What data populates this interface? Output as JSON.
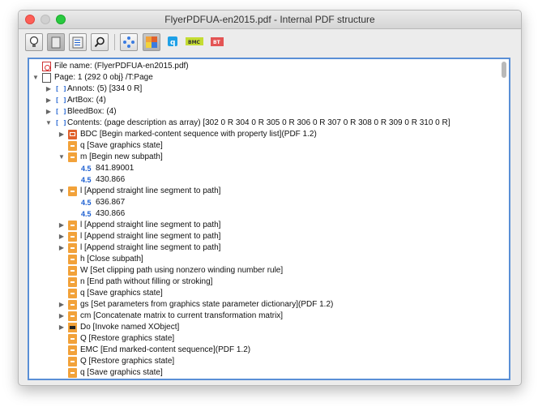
{
  "window": {
    "title": "FlyerPDFUA-en2015.pdf - Internal PDF structure"
  },
  "toolbar": {
    "buttons": [
      {
        "name": "bulb-icon-button",
        "icon": "lightbulb"
      },
      {
        "name": "page-view-button",
        "icon": "page",
        "active": true
      },
      {
        "name": "structure-view-button",
        "icon": "document-structure"
      },
      {
        "name": "search-button",
        "icon": "magnifier"
      },
      {
        "name": "nodes-button",
        "icon": "diamond-nodes"
      },
      {
        "name": "tree-colored-button",
        "icon": "colored-tree",
        "active": true
      },
      {
        "name": "q-button",
        "icon": "q-tag"
      },
      {
        "name": "bmc-button",
        "icon": "bmc-tag",
        "label": "BMC"
      },
      {
        "name": "bt-button",
        "icon": "bt-tag",
        "label": "BT"
      }
    ]
  },
  "tree": [
    {
      "level": 0,
      "tri": "",
      "icon": "pdf",
      "text": "File name: (FlyerPDFUA-en2015.pdf)"
    },
    {
      "level": 0,
      "tri": "down",
      "icon": "page",
      "text": "Page: 1  (292 0 obj}      /T:Page"
    },
    {
      "level": 1,
      "tri": "right",
      "icon": "arr",
      "text": "Annots:  (5) [334 0 R]"
    },
    {
      "level": 1,
      "tri": "right",
      "icon": "arr",
      "text": "ArtBox:  (4)"
    },
    {
      "level": 1,
      "tri": "right",
      "icon": "arr",
      "text": "BleedBox:  (4)"
    },
    {
      "level": 1,
      "tri": "down",
      "icon": "arr",
      "text": "Contents: (page description as array)   [302 0 R  304 0 R  305 0 R  306 0 R  307 0 R  308 0 R  309 0 R  310 0 R]"
    },
    {
      "level": 2,
      "tri": "right",
      "icon": "dict",
      "text": "BDC  [Begin marked-content sequence with property list](PDF 1.2)"
    },
    {
      "level": 2,
      "tri": "",
      "icon": "op",
      "text": "q  [Save graphics state]"
    },
    {
      "level": 2,
      "tri": "down",
      "icon": "op",
      "text": "m  [Begin new subpath]"
    },
    {
      "level": 3,
      "tri": "",
      "icon": "num",
      "text": "841.89001"
    },
    {
      "level": 3,
      "tri": "",
      "icon": "num",
      "text": "430.866"
    },
    {
      "level": 2,
      "tri": "down",
      "icon": "op",
      "text": "l  [Append straight line segment to path]"
    },
    {
      "level": 3,
      "tri": "",
      "icon": "num",
      "text": "636.867"
    },
    {
      "level": 3,
      "tri": "",
      "icon": "num",
      "text": "430.866"
    },
    {
      "level": 2,
      "tri": "right",
      "icon": "op",
      "text": "l  [Append straight line segment to path]"
    },
    {
      "level": 2,
      "tri": "right",
      "icon": "op",
      "text": "l  [Append straight line segment to path]"
    },
    {
      "level": 2,
      "tri": "right",
      "icon": "op",
      "text": "l  [Append straight line segment to path]"
    },
    {
      "level": 2,
      "tri": "",
      "icon": "op",
      "text": "h  [Close subpath]"
    },
    {
      "level": 2,
      "tri": "",
      "icon": "op",
      "text": "W  [Set clipping path using nonzero winding number rule]"
    },
    {
      "level": 2,
      "tri": "",
      "icon": "op",
      "text": "n  [End path without filling or stroking]"
    },
    {
      "level": 2,
      "tri": "",
      "icon": "op",
      "text": "q  [Save graphics state]"
    },
    {
      "level": 2,
      "tri": "right",
      "icon": "op",
      "text": "gs  [Set parameters from graphics state parameter dictionary](PDF 1.2)"
    },
    {
      "level": 2,
      "tri": "right",
      "icon": "op",
      "text": "cm  [Concatenate matrix to current transformation matrix]"
    },
    {
      "level": 2,
      "tri": "right",
      "icon": "do",
      "text": "Do  [Invoke named XObject]"
    },
    {
      "level": 2,
      "tri": "",
      "icon": "op",
      "text": "Q  [Restore graphics state]"
    },
    {
      "level": 2,
      "tri": "",
      "icon": "op",
      "text": "EMC  [End marked-content sequence](PDF 1.2)"
    },
    {
      "level": 2,
      "tri": "",
      "icon": "op",
      "text": "Q  [Restore graphics state]"
    },
    {
      "level": 2,
      "tri": "",
      "icon": "op",
      "text": "q  [Save graphics state]"
    }
  ]
}
